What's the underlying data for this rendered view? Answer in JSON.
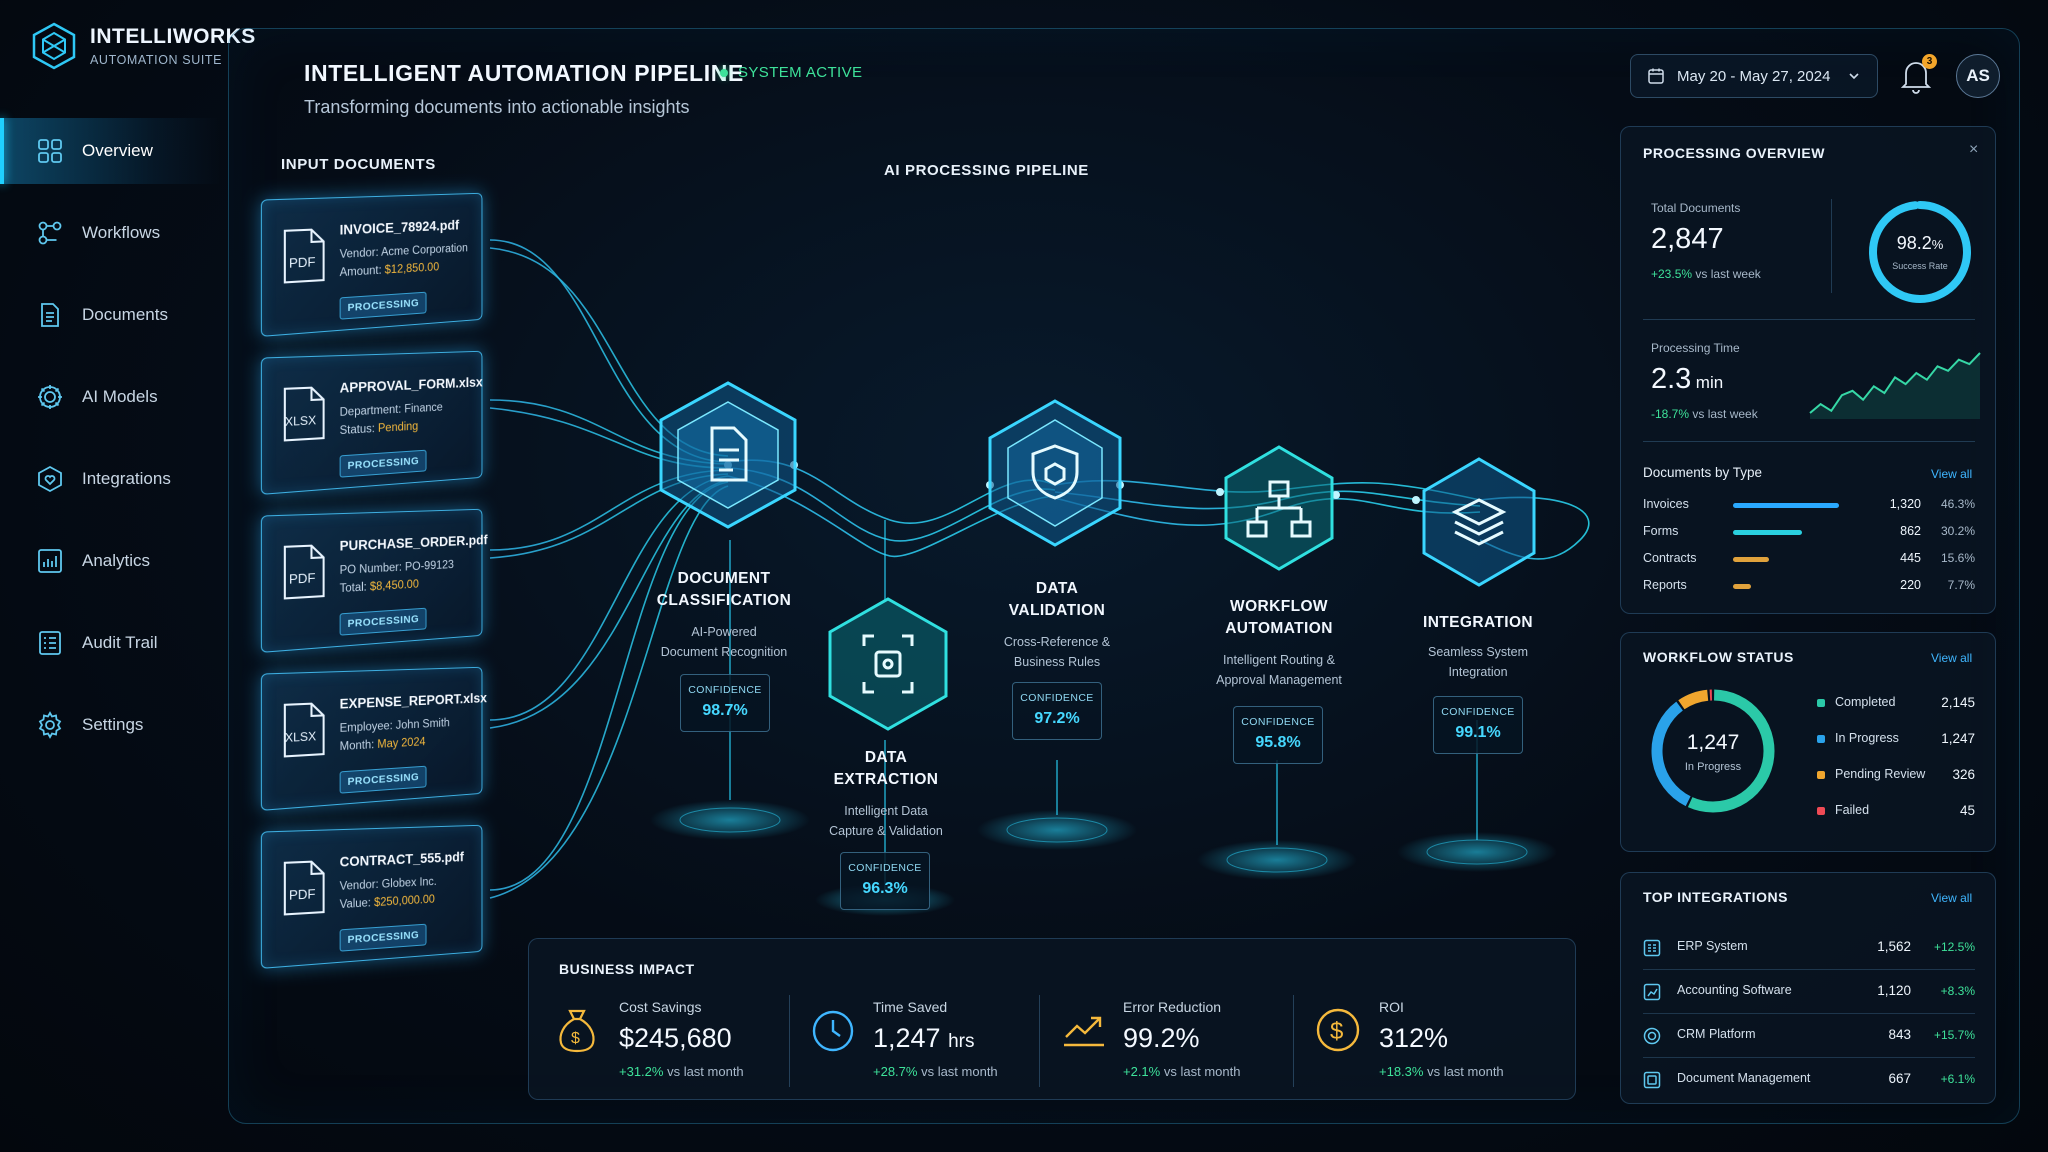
{
  "brand": {
    "name": "INTELLIWORKS",
    "subtitle": "AUTOMATION SUITE"
  },
  "nav": {
    "items": [
      {
        "label": "Overview",
        "icon": "grid-icon",
        "active": true
      },
      {
        "label": "Workflows",
        "icon": "workflow-icon"
      },
      {
        "label": "Documents",
        "icon": "document-icon"
      },
      {
        "label": "AI Models",
        "icon": "ai-chip-icon"
      },
      {
        "label": "Integrations",
        "icon": "shield-heart-icon"
      },
      {
        "label": "Analytics",
        "icon": "chart-icon"
      },
      {
        "label": "Audit Trail",
        "icon": "list-icon"
      },
      {
        "label": "Settings",
        "icon": "gear-icon"
      }
    ]
  },
  "header": {
    "title": "INTELLIGENT AUTOMATION PIPELINE",
    "status": "SYSTEM ACTIVE",
    "subtitle": "Transforming documents into actionable insights",
    "date_range": "May 20 - May 27, 2024",
    "notifications": "3",
    "avatar": "AS"
  },
  "colors": {
    "accent": "#1fd0ff",
    "success": "#3ee29a",
    "warning": "#f5b93c",
    "danger": "#ef4a55",
    "bg": "#050c16"
  },
  "inputs": {
    "label": "INPUT DOCUMENTS",
    "docs": [
      {
        "name": "INVOICE_78924.pdf",
        "type": "PDF",
        "line1": "Vendor: Acme Corporation",
        "line2_prefix": "Amount: ",
        "line2_value": "$12,850.00",
        "status": "PROCESSING"
      },
      {
        "name": "APPROVAL_FORM.xlsx",
        "type": "XLSX",
        "line1": "Department: Finance",
        "line2_prefix": "Status: ",
        "line2_value": "Pending",
        "status": "PROCESSING"
      },
      {
        "name": "PURCHASE_ORDER.pdf",
        "type": "PDF",
        "line1": "PO Number: PO-99123",
        "line2_prefix": "Total: ",
        "line2_value": "$8,450.00",
        "status": "PROCESSING"
      },
      {
        "name": "EXPENSE_REPORT.xlsx",
        "type": "XLSX",
        "line1": "Employee: John Smith",
        "line2_prefix": "Month: ",
        "line2_value": "May 2024",
        "status": "PROCESSING"
      },
      {
        "name": "CONTRACT_555.pdf",
        "type": "PDF",
        "line1": "Vendor: Globex Inc.",
        "line2_prefix": "Value: ",
        "line2_value": "$250,000.00",
        "status": "PROCESSING"
      }
    ]
  },
  "pipeline": {
    "label": "AI PROCESSING PIPELINE",
    "stages": [
      {
        "title1": "DOCUMENT",
        "title2": "CLASSIFICATION",
        "desc1": "AI-Powered",
        "desc2": "Document Recognition",
        "conf_label": "CONFIDENCE",
        "conf": "98.7%",
        "icon": "document-icon"
      },
      {
        "title1": "DATA",
        "title2": "EXTRACTION",
        "desc1": "Intelligent Data",
        "desc2": "Capture & Validation",
        "conf_label": "CONFIDENCE",
        "conf": "96.3%",
        "icon": "scan-icon"
      },
      {
        "title1": "DATA",
        "title2": "VALIDATION",
        "desc1": "Cross-Reference &",
        "desc2": "Business Rules",
        "conf_label": "CONFIDENCE",
        "conf": "97.2%",
        "icon": "shield-icon"
      },
      {
        "title1": "WORKFLOW",
        "title2": "AUTOMATION",
        "desc1": "Intelligent Routing &",
        "desc2": "Approval Management",
        "conf_label": "CONFIDENCE",
        "conf": "95.8%",
        "icon": "hierarchy-icon"
      },
      {
        "title1": "INTEGRATION",
        "title2": "",
        "desc1": "Seamless System",
        "desc2": "Integration",
        "conf_label": "CONFIDENCE",
        "conf": "99.1%",
        "icon": "layers-icon"
      }
    ]
  },
  "impact": {
    "title": "BUSINESS IMPACT",
    "items": [
      {
        "label": "Cost Savings",
        "value": "$245,680",
        "unit": "",
        "delta": "+31.2%",
        "delta_suffix": "vs last month",
        "icon": "money-bag-icon"
      },
      {
        "label": "Time Saved",
        "value": "1,247",
        "unit": "hrs",
        "delta": "+28.7%",
        "delta_suffix": "vs last month",
        "icon": "clock-icon"
      },
      {
        "label": "Error Reduction",
        "value": "99.2%",
        "unit": "",
        "delta": "+2.1%",
        "delta_suffix": "vs last month",
        "icon": "trend-up-icon"
      },
      {
        "label": "ROI",
        "value": "312%",
        "unit": "",
        "delta": "+18.3%",
        "delta_suffix": "vs last month",
        "icon": "dollar-coin-icon"
      }
    ]
  },
  "overview": {
    "title": "PROCESSING OVERVIEW",
    "total_label": "Total Documents",
    "total": "2,847",
    "total_delta": "+23.5%",
    "total_delta_suffix": "vs last week",
    "success_rate": "98.2",
    "success_pct_sign": "%",
    "success_label": "Success Rate",
    "success_fraction": 0.982,
    "time_label": "Processing Time",
    "time_value": "2.3",
    "time_unit": "min",
    "time_delta": "-18.7%",
    "time_delta_suffix": "vs last week",
    "sparkline": [
      3,
      2.6,
      2.9,
      2.2,
      2.0,
      2.4,
      1.8,
      2.1,
      1.4,
      1.7,
      1.2,
      1.5,
      0.9,
      1.1,
      0.6,
      0.8,
      0.3
    ],
    "by_type_title": "Documents by Type",
    "view_all": "View all",
    "types": [
      {
        "label": "Invoices",
        "count": "1,320",
        "pct": "46.3%",
        "fraction": 0.463,
        "color": "#2aa9ff"
      },
      {
        "label": "Forms",
        "count": "862",
        "pct": "30.2%",
        "fraction": 0.302,
        "color": "#2ad0e0"
      },
      {
        "label": "Contracts",
        "count": "445",
        "pct": "15.6%",
        "fraction": 0.156,
        "color": "#e0a23c"
      },
      {
        "label": "Reports",
        "count": "220",
        "pct": "7.7%",
        "fraction": 0.077,
        "color": "#e0a23c"
      }
    ]
  },
  "workflow": {
    "title": "WORKFLOW STATUS",
    "view_all": "View all",
    "center_value": "1,247",
    "center_label": "In Progress",
    "statuses": [
      {
        "label": "Completed",
        "count": "2,145",
        "value": 2145,
        "color": "#2bc9a8"
      },
      {
        "label": "In Progress",
        "count": "1,247",
        "value": 1247,
        "color": "#2aa2ea"
      },
      {
        "label": "Pending Review",
        "count": "326",
        "value": 326,
        "color": "#f0a62e"
      },
      {
        "label": "Failed",
        "count": "45",
        "value": 45,
        "color": "#ef4a55"
      }
    ]
  },
  "integrations": {
    "title": "TOP INTEGRATIONS",
    "view_all": "View all",
    "items": [
      {
        "label": "ERP System",
        "count": "1,562",
        "delta": "+12.5%",
        "icon": "erp-icon"
      },
      {
        "label": "Accounting Software",
        "count": "1,120",
        "delta": "+8.3%",
        "icon": "accounting-icon"
      },
      {
        "label": "CRM Platform",
        "count": "843",
        "delta": "+15.7%",
        "icon": "crm-icon"
      },
      {
        "label": "Document Management",
        "count": "667",
        "delta": "+6.1%",
        "icon": "docmgmt-icon"
      }
    ]
  }
}
